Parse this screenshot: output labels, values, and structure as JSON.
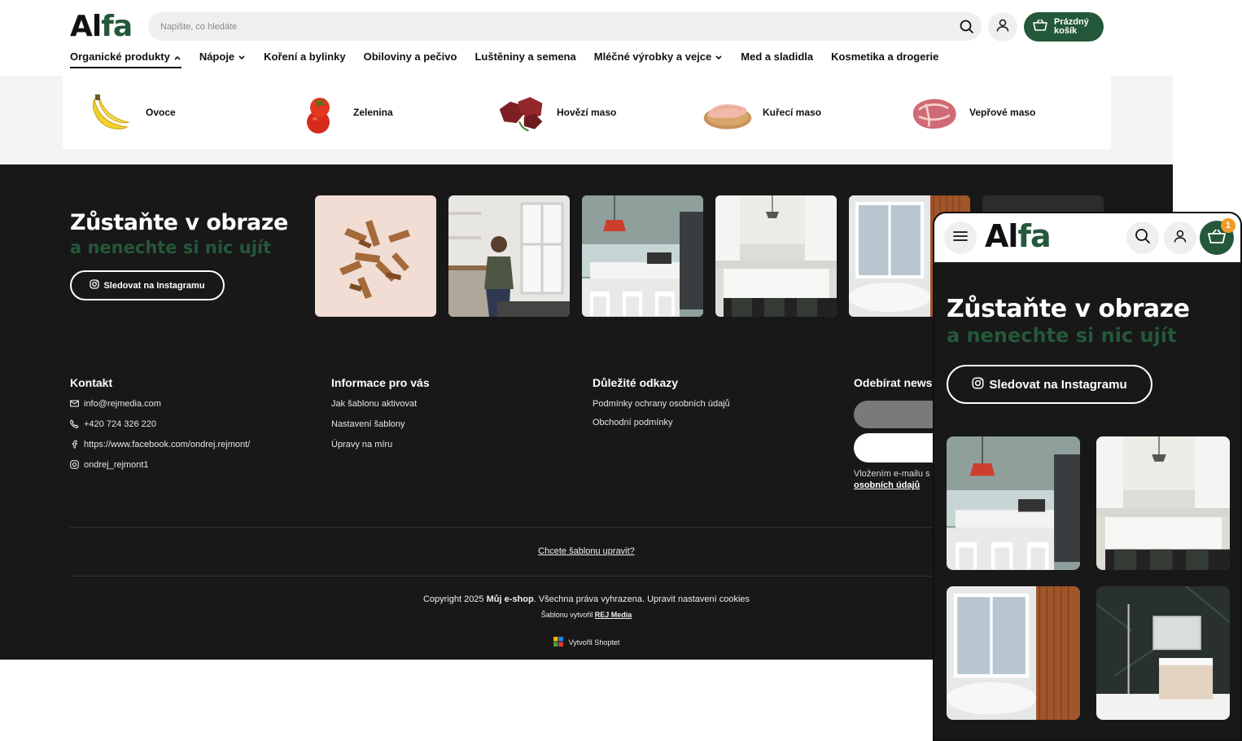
{
  "brand": {
    "logo_main": "Al",
    "logo_accent": "fa",
    "accent_color": "#24583a"
  },
  "header": {
    "search_placeholder": "Napište, co hledáte",
    "cart_label": "Prázdný košík"
  },
  "nav": [
    {
      "label": "Organické produkty"
    },
    {
      "label": "Nápoje"
    },
    {
      "label": "Koření a bylinky"
    },
    {
      "label": "Obiloviny a pečivo"
    },
    {
      "label": "Luštěniny a semena"
    },
    {
      "label": "Mléčné výrobky a vejce"
    },
    {
      "label": "Med a sladidla"
    },
    {
      "label": "Kosmetika a drogerie"
    }
  ],
  "categories": [
    {
      "label": "Ovoce"
    },
    {
      "label": "Zelenina"
    },
    {
      "label": "Hovězí maso"
    },
    {
      "label": "Kuřecí maso"
    },
    {
      "label": "Vepřové maso"
    }
  ],
  "instagram": {
    "title": "Zůstaňte v obraze",
    "subtitle": "a nenechte si nic ujít",
    "button": "Sledovat na Instagramu"
  },
  "footer": {
    "contact": {
      "heading": "Kontakt",
      "email": "info@rejmedia.com",
      "phone": "+420 724 326 220",
      "facebook": "https://www.facebook.com/ondrej.rejmont/",
      "instagram": "ondrej_rejmont1"
    },
    "info": {
      "heading": "Informace pro vás",
      "links": [
        "Jak šablonu aktivovat",
        "Nastavení šablony",
        "Úpravy na míru"
      ]
    },
    "important": {
      "heading": "Důležité odkazy",
      "links": [
        "Podmínky ochrany osobních údajů",
        "Obchodní podmínky"
      ]
    },
    "newsletter": {
      "heading": "Odebírat newsle",
      "note_line1": "Vložením e-mailu s",
      "note_link": "osobních údajů"
    },
    "edit_link": "Chcete šablonu upravit?",
    "copyright_pre": "Copyright 2025",
    "copyright_shop": "Můj e-shop",
    "copyright_post": ". Všechna práva vyhrazena. Upravit nastavení cookies",
    "author_pre": "Šablonu vytvořil",
    "author_link": "REJ Media",
    "shoptet": "Vytvořil Shoptet"
  },
  "mobile": {
    "cart_count": "1",
    "title": "Zůstaňte v obraze",
    "subtitle": "a nenechte si nic ujít",
    "button": "Sledovat na Instagramu"
  }
}
